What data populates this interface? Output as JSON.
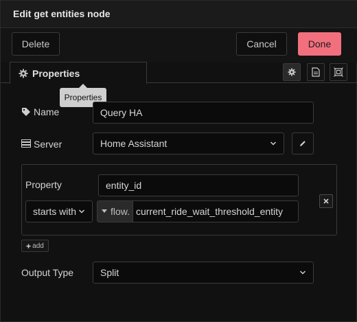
{
  "dialog": {
    "title": "Edit get entities node"
  },
  "toolbar": {
    "delete_label": "Delete",
    "cancel_label": "Cancel",
    "done_label": "Done"
  },
  "tabs": [
    {
      "label": "Properties",
      "icon": "gear-icon",
      "active": true
    }
  ],
  "side_icons": [
    "gear-icon",
    "description-icon",
    "appearance-icon"
  ],
  "tooltip": "Properties",
  "form": {
    "name": {
      "label": "Name",
      "icon": "tag-icon",
      "value": "Query HA"
    },
    "server": {
      "label": "Server",
      "icon": "server-icon",
      "value": "Home Assistant",
      "edit_icon": "pencil-icon"
    },
    "rule": {
      "property_label": "Property",
      "property_value": "entity_id",
      "operator": "starts with",
      "value_type": "flow.",
      "value": "current_ride_wait_threshold_entity"
    },
    "add_label": "add",
    "output_type": {
      "label": "Output Type",
      "value": "Split"
    }
  },
  "colors": {
    "done_button": "#f2707e",
    "background": "#111111",
    "border": "#3a3a3a"
  }
}
